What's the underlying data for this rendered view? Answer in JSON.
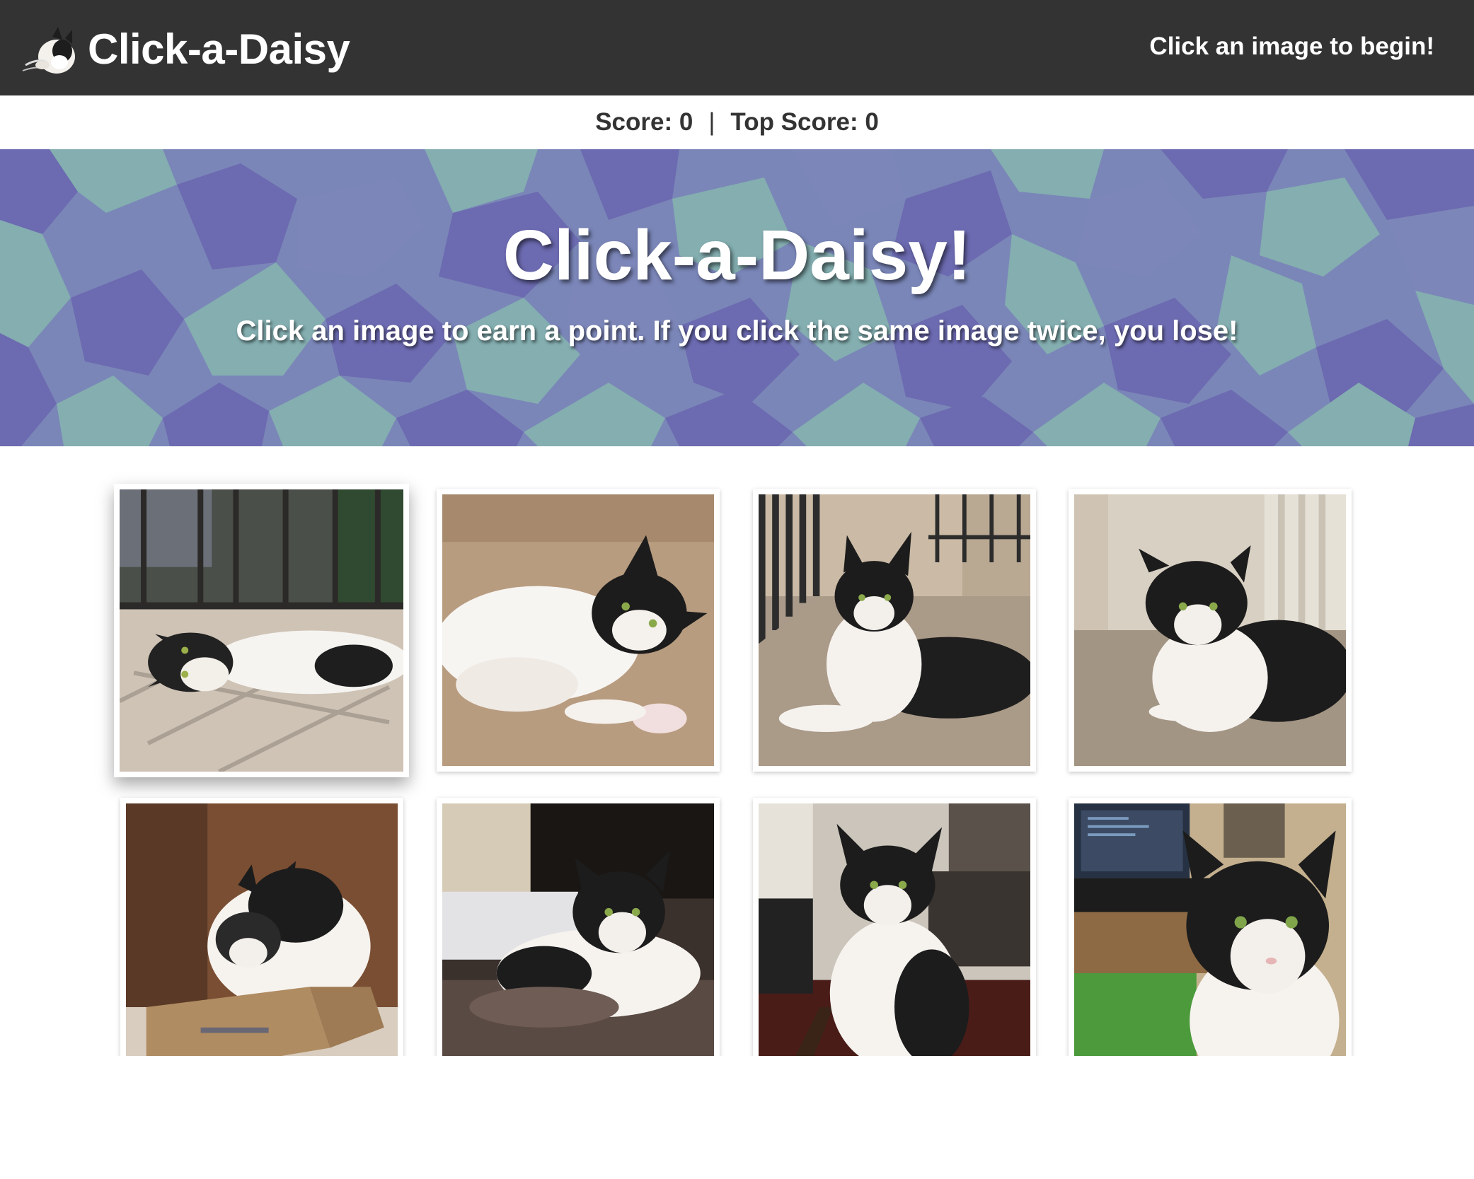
{
  "navbar": {
    "brand": "Click-a-Daisy",
    "message": "Click an image to begin!",
    "logo_icon": "cat-logo-icon"
  },
  "scoreboard": {
    "score_label": "Score: 0",
    "separator": "|",
    "top_score_label": "Top Score: 0"
  },
  "hero": {
    "title": "Click-a-Daisy!",
    "subtitle": "Click an image to earn a point. If you click the same image twice, you lose!",
    "pattern_colors": [
      "#6c6ab0",
      "#7c86b8",
      "#84aeb0",
      "#6e9ea8"
    ]
  },
  "images": [
    {
      "name": "cat-photo-1",
      "scene": "lying on sunny balcony"
    },
    {
      "name": "cat-photo-2",
      "scene": "lying on carpet"
    },
    {
      "name": "cat-photo-3",
      "scene": "on porch by railing"
    },
    {
      "name": "cat-photo-4",
      "scene": "lying on concrete"
    },
    {
      "name": "cat-photo-5",
      "scene": "in cardboard box"
    },
    {
      "name": "cat-photo-6",
      "scene": "on blanket"
    },
    {
      "name": "cat-photo-7",
      "scene": "sitting on guitar case"
    },
    {
      "name": "cat-photo-8",
      "scene": "by computer desk"
    }
  ],
  "colors": {
    "navbar": "#333333",
    "text_dark": "#333333",
    "white": "#ffffff"
  }
}
